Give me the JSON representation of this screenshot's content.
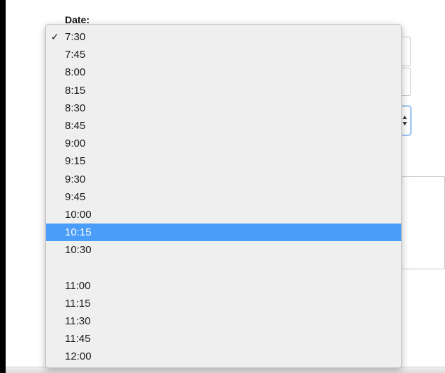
{
  "form": {
    "date_label": "Date:"
  },
  "time_menu": {
    "selected_index": 0,
    "highlighted_index": 11,
    "checkmark": "✓",
    "highlight_color": "#4a9df8",
    "items": [
      {
        "label": "7:30"
      },
      {
        "label": "7:45"
      },
      {
        "label": "8:00"
      },
      {
        "label": "8:15"
      },
      {
        "label": "8:30"
      },
      {
        "label": "8:45"
      },
      {
        "label": "9:00"
      },
      {
        "label": "9:15"
      },
      {
        "label": "9:30"
      },
      {
        "label": "9:45"
      },
      {
        "label": "10:00"
      },
      {
        "label": "10:15"
      },
      {
        "label": "10:30"
      },
      {
        "label": ""
      },
      {
        "label": "11:00"
      },
      {
        "label": "11:15"
      },
      {
        "label": "11:30"
      },
      {
        "label": "11:45"
      },
      {
        "label": "12:00"
      }
    ]
  }
}
